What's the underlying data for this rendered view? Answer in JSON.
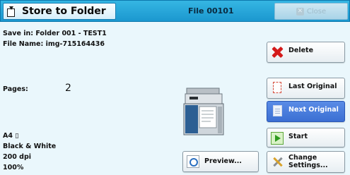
{
  "header": {
    "title": "Store to Folder",
    "file_label": "File 00101",
    "close_label": "Close"
  },
  "info": {
    "save_in": "Save in: Folder 001 - TEST1",
    "file_name": "File Name: img-715164436",
    "pages_label": "Pages:",
    "pages_value": "2",
    "paper": "A4 ▯",
    "color_mode": "Black & White",
    "resolution": "200 dpi",
    "scale": "100%"
  },
  "buttons": {
    "delete": "Delete",
    "last_original": "Last Original",
    "next_original": "Next Original",
    "start": "Start",
    "change_settings_line1": "Change",
    "change_settings_line2": "Settings...",
    "preview": "Preview..."
  },
  "icons": {
    "title": "store-to-folder-icon",
    "close": "close-icon",
    "delete": "delete-x-icon",
    "last_original": "last-original-icon",
    "next_original": "next-original-icon",
    "start": "start-icon",
    "change_settings": "tools-icon",
    "preview": "preview-magnifier-icon",
    "machine": "multifunction-printer-illustration"
  },
  "colors": {
    "header": "#1b97cf",
    "background": "#eaf7fc",
    "selected_button": "#3b6fd3",
    "delete_red": "#d41a1a",
    "start_green": "#2f9a1e"
  }
}
